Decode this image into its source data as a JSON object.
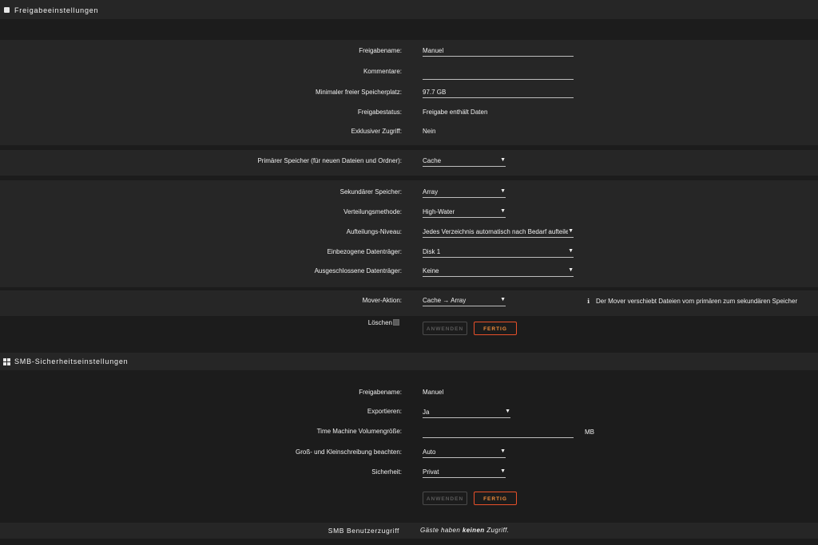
{
  "share_settings": {
    "title": "Freigabeeinstellungen",
    "name_label": "Freigabename:",
    "name_value": "Manuel",
    "comments_label": "Kommentare:",
    "comments_value": "",
    "min_free_label": "Minimaler freier Speicherplatz:",
    "min_free_value": "97.7 GB",
    "status_label": "Freigabestatus:",
    "status_value": "Freigabe enthält Daten",
    "exclusive_label": "Exklusiver Zugriff:",
    "exclusive_value": "Nein",
    "primary_label": "Primärer Speicher (für neuen Dateien und Ordner):",
    "primary_value": "Cache",
    "secondary_label": "Sekundärer Speicher:",
    "secondary_value": "Array",
    "allocation_label": "Verteilungsmethode:",
    "allocation_value": "High-Water",
    "split_label": "Aufteilungs-Niveau:",
    "split_value": "Jedes Verzeichnis automatisch nach Bedarf aufteilen",
    "included_label": "Einbezogene Datenträger:",
    "included_value": "Disk 1",
    "excluded_label": "Ausgeschlossene Datenträger:",
    "excluded_value": "Keine",
    "mover_label": "Mover-Aktion:",
    "mover_value": "Cache → Array",
    "mover_info": "Der Mover verschiebt Dateien vom primären zum sekundären Speicher",
    "delete_label": "Löschen",
    "apply_label": "ANWENDEN",
    "done_label": "FERTIG"
  },
  "smb_settings": {
    "title": "SMB-Sicherheitseinstellungen",
    "name_label": "Freigabename:",
    "name_value": "Manuel",
    "export_label": "Exportieren:",
    "export_value": "Ja",
    "tm_label": "Time Machine Volumengröße:",
    "tm_value": "",
    "tm_unit": "MB",
    "case_label": "Groß- und Kleinschreibung beachten:",
    "case_value": "Auto",
    "security_label": "Sicherheit:",
    "security_value": "Privat",
    "apply_label": "ANWENDEN",
    "done_label": "FERTIG"
  },
  "smb_user_access": {
    "label": "SMB Benutzerzugriff",
    "text_before": "Gäste haben ",
    "text_bold": "keinen",
    "text_after": " Zugriff."
  },
  "colors": {
    "background": "#1c1c1c",
    "band": "#262626",
    "accent_border": "#e8502a",
    "accent_text": "#f08c3a"
  }
}
